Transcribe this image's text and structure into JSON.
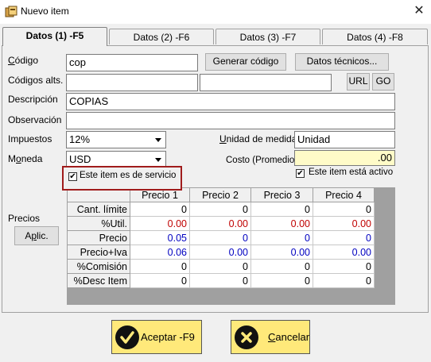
{
  "window": {
    "title": "Nuevo item",
    "close_glyph": "✕"
  },
  "tabs": [
    {
      "label": "Datos (1) -F5",
      "active": true
    },
    {
      "label": "Datos (2) -F6",
      "active": false
    },
    {
      "label": "Datos (3) -F7",
      "active": false
    },
    {
      "label": "Datos (4) -F8",
      "active": false
    }
  ],
  "form": {
    "codigo_label": "Código",
    "codigo_value": "cop",
    "generar_codigo": "Generar código",
    "datos_tecnicos": "Datos técnicos...",
    "codigos_alts_label": "Códigos alts.",
    "codigo_alt_1": "",
    "codigo_alt_2": "",
    "url_button": "URL",
    "go_button": "GO",
    "descripcion_label": "Descripción",
    "descripcion_value": "COPIAS",
    "observacion_label": "Observación",
    "observacion_value": "",
    "impuestos_label": "Impuestos",
    "impuestos_value": "12%",
    "moneda_label": "Moneda",
    "moneda_value": "USD",
    "unidad_label": "Unidad de medida",
    "unidad_value": "Unidad",
    "costo_label": "Costo (Promedio)",
    "costo_value": ".00",
    "servicio_label": "Este item es de servicio",
    "servicio_checked": true,
    "activo_label": "Este item está activo",
    "activo_checked": true,
    "precios_label": "Precios",
    "aplic_button": "Aplic."
  },
  "price_grid": {
    "columns": [
      "Precio 1",
      "Precio 2",
      "Precio 3",
      "Precio 4"
    ],
    "rows": [
      {
        "label": "Cant. límite",
        "color": "black",
        "values": [
          "0",
          "0",
          "0",
          "0"
        ]
      },
      {
        "label": "%Util.",
        "color": "red",
        "values": [
          "0.00",
          "0.00",
          "0.00",
          "0.00"
        ]
      },
      {
        "label": "Precio",
        "color": "blue",
        "values": [
          "0.05",
          "0",
          "0",
          "0"
        ]
      },
      {
        "label": "Precio+Iva",
        "color": "blue",
        "values": [
          "0.06",
          "0.00",
          "0.00",
          "0.00"
        ]
      },
      {
        "label": "%Comisión",
        "color": "black",
        "values": [
          "0",
          "0",
          "0",
          "0"
        ]
      },
      {
        "label": "%Desc Item",
        "color": "black",
        "values": [
          "0",
          "0",
          "0",
          "0"
        ]
      }
    ]
  },
  "actions": {
    "aceptar": "Aceptar -F9",
    "cancelar": "Cancelar"
  },
  "colors": {
    "highlight_box": "#a01c1c",
    "button_yellow": "#ffe97a",
    "costo_bg": "#fffbc8"
  }
}
